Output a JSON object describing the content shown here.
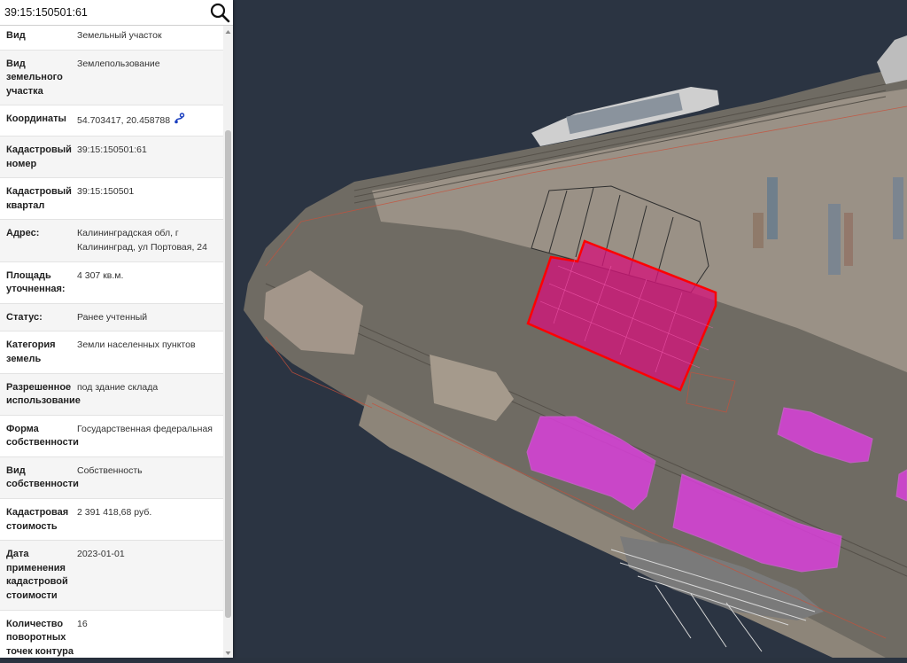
{
  "search": {
    "value": "39:15:150501:61",
    "icon": "magnifier-icon"
  },
  "properties": [
    {
      "key": "Вид",
      "value": "Земельный участок"
    },
    {
      "key": "Вид земельного участка",
      "value": "Землепользование"
    },
    {
      "key": "Координаты",
      "value": "54.703417, 20.458788",
      "icon": "route-icon"
    },
    {
      "key": "Кадастровый номер",
      "value": "39:15:150501:61"
    },
    {
      "key": "Кадастровый квартал",
      "value": "39:15:150501"
    },
    {
      "key": "Адрес:",
      "value": "Калининградская обл, г Калининград, ул Портовая, 24"
    },
    {
      "key": "Площадь уточненная:",
      "value": "4 307 кв.м."
    },
    {
      "key": "Статус:",
      "value": "Ранее учтенный"
    },
    {
      "key": "Категория земель",
      "value": "Земли населенных пунктов"
    },
    {
      "key": "Разрешенное использование",
      "value": "под здание склада"
    },
    {
      "key": "Форма собственности",
      "value": "Государственная федеральная"
    },
    {
      "key": "Вид собственности",
      "value": "Собственность"
    },
    {
      "key": "Кадастровая стоимость",
      "value": "2 391 418,68 руб."
    },
    {
      "key": "Дата применения кадастровой стоимости",
      "value": "2023-01-01"
    },
    {
      "key": "Количество поворотных точек контура",
      "value": "16"
    }
  ],
  "colors": {
    "selected_parcel_fill": "#d4147a",
    "selected_parcel_stroke": "#ff0000",
    "building_fill": "#d93fd9",
    "link_blue": "#1a3fbf"
  }
}
